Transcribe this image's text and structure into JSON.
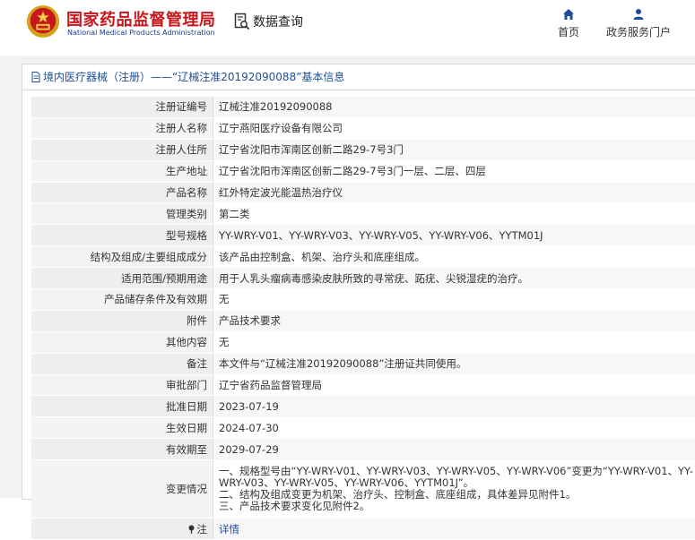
{
  "header": {
    "logo_cn": "国家药品监督管理局",
    "logo_en": "National Medical Products Administration",
    "query_label": "数据查询",
    "nav": [
      {
        "label": "首页",
        "icon": "home-icon"
      },
      {
        "label": "政务服务门户",
        "icon": "user-icon"
      }
    ]
  },
  "panel": {
    "title": "境内医疗器械（注册）——“辽械注准20192090088”基本信息"
  },
  "fields": [
    {
      "key": "注册证编号",
      "value": "辽械注准20192090088"
    },
    {
      "key": "注册人名称",
      "value": "辽宁燕阳医疗设备有限公司"
    },
    {
      "key": "注册人住所",
      "value": "辽宁省沈阳市浑南区创新二路29-7号3门"
    },
    {
      "key": "生产地址",
      "value": "辽宁省沈阳市浑南区创新二路29-7号3门一层、二层、四层"
    },
    {
      "key": "产品名称",
      "value": "红外特定波光能温热治疗仪"
    },
    {
      "key": "管理类别",
      "value": "第二类"
    },
    {
      "key": "型号规格",
      "value": "YY-WRY-V01、YY-WRY-V03、YY-WRY-V05、YY-WRY-V06、YYTM01J"
    },
    {
      "key": "结构及组成/主要组成成分",
      "value": "该产品由控制盒、机架、治疗头和底座组成。"
    },
    {
      "key": "适用范围/预期用途",
      "value": "用于人乳头瘤病毒感染皮肤所致的寻常疣、跖疣、尖锐湿疣的治疗。"
    },
    {
      "key": "产品储存条件及有效期",
      "value": "无"
    },
    {
      "key": "附件",
      "value": "产品技术要求"
    },
    {
      "key": "其他内容",
      "value": "无"
    },
    {
      "key": "备注",
      "value": "本文件与“辽械注准20192090088”注册证共同使用。"
    },
    {
      "key": "审批部门",
      "value": "辽宁省药品监督管理局"
    },
    {
      "key": "批准日期",
      "value": "2023-07-19"
    },
    {
      "key": "生效日期",
      "value": "2024-07-30"
    },
    {
      "key": "有效期至",
      "value": "2029-07-29"
    }
  ],
  "changes": {
    "key": "变更情况",
    "lines": [
      "一、规格型号由“YY-WRY-V01、YY-WRY-V03、YY-WRY-V05、YY-WRY-V06”变更为“YY-WRY-V01、YY-WRY-V03、YY-WRY-V05、YY-WRY-V06、YYTM01J”。",
      "二、结构及组成变更为机架、治疗头、控制盒、底座组成，具体差异见附件1。",
      "三、产品技术要求变化见附件2。"
    ]
  },
  "note": {
    "key": "注",
    "link": "详情"
  }
}
